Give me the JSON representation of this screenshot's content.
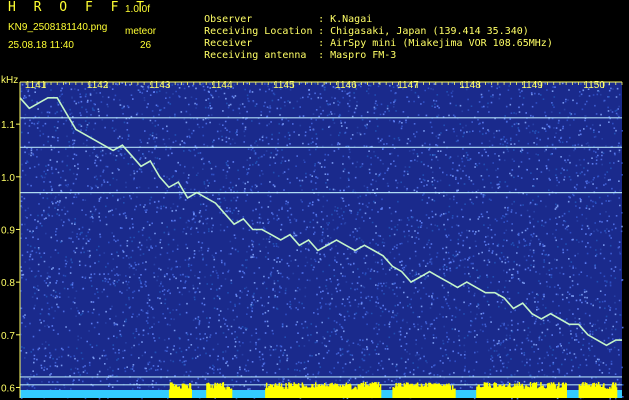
{
  "header": {
    "app_title": "H R O F F T",
    "version": "1.0.0f",
    "file_name": "KN9_2508181140.png",
    "datetime": "25.08.18 11:40",
    "meteor_label": "meteor",
    "meteor_count": "26",
    "info": [
      {
        "label": "Observer",
        "value": "K.Nagai"
      },
      {
        "label": "Receiving Location",
        "value": "Chigasaki, Japan (139.414 35.340)"
      },
      {
        "label": "Receiver",
        "value": "AirSpy mini (Miakejima VOR 108.65MHz)"
      },
      {
        "label": "Receiving antenna",
        "value": "Maspro FM-3"
      }
    ]
  },
  "colors": {
    "background": "#000000",
    "header_text": "#ffff66",
    "spectrogram_base": "#1a2a8c",
    "baseline_cyan": "#33ccff",
    "meteor_yellow": "#ffff00",
    "trace": "#ccffcc"
  },
  "chart_data": {
    "type": "heatmap",
    "y_unit_label": "kHz",
    "ylim": [
      0.58,
      1.18
    ],
    "y_ticks": [
      0.6,
      0.7,
      0.8,
      0.9,
      1.0,
      1.1
    ],
    "x_ticks": [
      "1141",
      "1142",
      "1143",
      "1144",
      "1145",
      "1146",
      "1147",
      "1148",
      "1149",
      "1150"
    ],
    "x_range_minutes": [
      1140.6,
      1150.3
    ],
    "horizontal_lines_khz": [
      1.112,
      1.056,
      0.97,
      0.62,
      0.605
    ],
    "trace": {
      "x": [
        1140.6,
        1140.75,
        1140.9,
        1141.05,
        1141.2,
        1141.35,
        1141.5,
        1141.65,
        1141.8,
        1141.95,
        1142.1,
        1142.25,
        1142.4,
        1142.55,
        1142.7,
        1142.85,
        1143.0,
        1143.15,
        1143.3,
        1143.45,
        1143.6,
        1143.75,
        1143.9,
        1144.05,
        1144.2,
        1144.35,
        1144.5,
        1144.65,
        1144.8,
        1144.95,
        1145.1,
        1145.25,
        1145.4,
        1145.55,
        1145.7,
        1145.85,
        1146.0,
        1146.15,
        1146.3,
        1146.45,
        1146.6,
        1146.75,
        1146.9,
        1147.05,
        1147.2,
        1147.35,
        1147.5,
        1147.65,
        1147.8,
        1147.95,
        1148.1,
        1148.25,
        1148.4,
        1148.55,
        1148.7,
        1148.85,
        1149.0,
        1149.15,
        1149.3,
        1149.45,
        1149.6,
        1149.75,
        1149.9,
        1150.05,
        1150.2,
        1150.3
      ],
      "y": [
        1.15,
        1.13,
        1.14,
        1.15,
        1.15,
        1.12,
        1.09,
        1.08,
        1.07,
        1.06,
        1.05,
        1.06,
        1.04,
        1.02,
        1.03,
        1.0,
        0.98,
        0.99,
        0.96,
        0.97,
        0.96,
        0.95,
        0.93,
        0.91,
        0.92,
        0.9,
        0.9,
        0.89,
        0.88,
        0.89,
        0.87,
        0.88,
        0.86,
        0.87,
        0.88,
        0.87,
        0.86,
        0.87,
        0.86,
        0.85,
        0.83,
        0.82,
        0.8,
        0.81,
        0.82,
        0.81,
        0.8,
        0.79,
        0.8,
        0.79,
        0.78,
        0.78,
        0.77,
        0.75,
        0.76,
        0.74,
        0.73,
        0.74,
        0.73,
        0.72,
        0.72,
        0.7,
        0.69,
        0.68,
        0.69,
        0.69
      ]
    }
  }
}
